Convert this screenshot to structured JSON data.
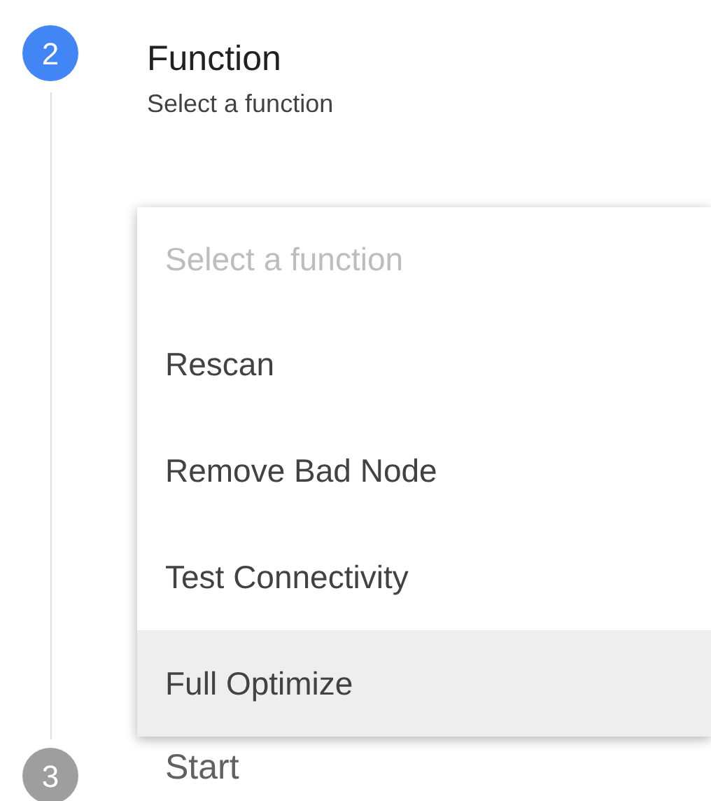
{
  "steps": [
    {
      "number": "2",
      "title": "Function",
      "subtitle": "Select a function",
      "active": true
    },
    {
      "number": "3",
      "title": "Start",
      "active": false
    }
  ],
  "dropdown": {
    "placeholder": "Select a function",
    "options": [
      {
        "label": "Rescan",
        "selected": false
      },
      {
        "label": "Remove Bad Node",
        "selected": false
      },
      {
        "label": "Test Connectivity",
        "selected": false
      },
      {
        "label": "Full Optimize",
        "selected": true
      }
    ]
  }
}
